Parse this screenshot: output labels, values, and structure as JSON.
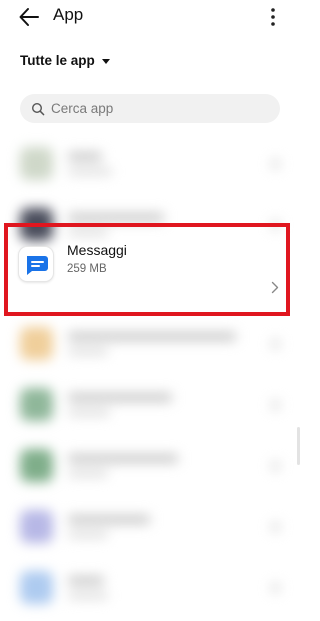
{
  "header": {
    "title": "App",
    "back_icon": "arrow-left-icon",
    "more_icon": "more-vertical-icon"
  },
  "filter": {
    "label": "Tutte le app",
    "icon": "caret-down-icon"
  },
  "search": {
    "placeholder": "Cerca app",
    "value": "",
    "icon": "search-icon"
  },
  "apps": [
    {
      "name": "Messaggi",
      "size": "259 MB",
      "highlighted": true,
      "icon": "messages-icon"
    }
  ],
  "colors": {
    "highlight_border": "#e0161f",
    "messages_blue": "#1a73e8"
  }
}
